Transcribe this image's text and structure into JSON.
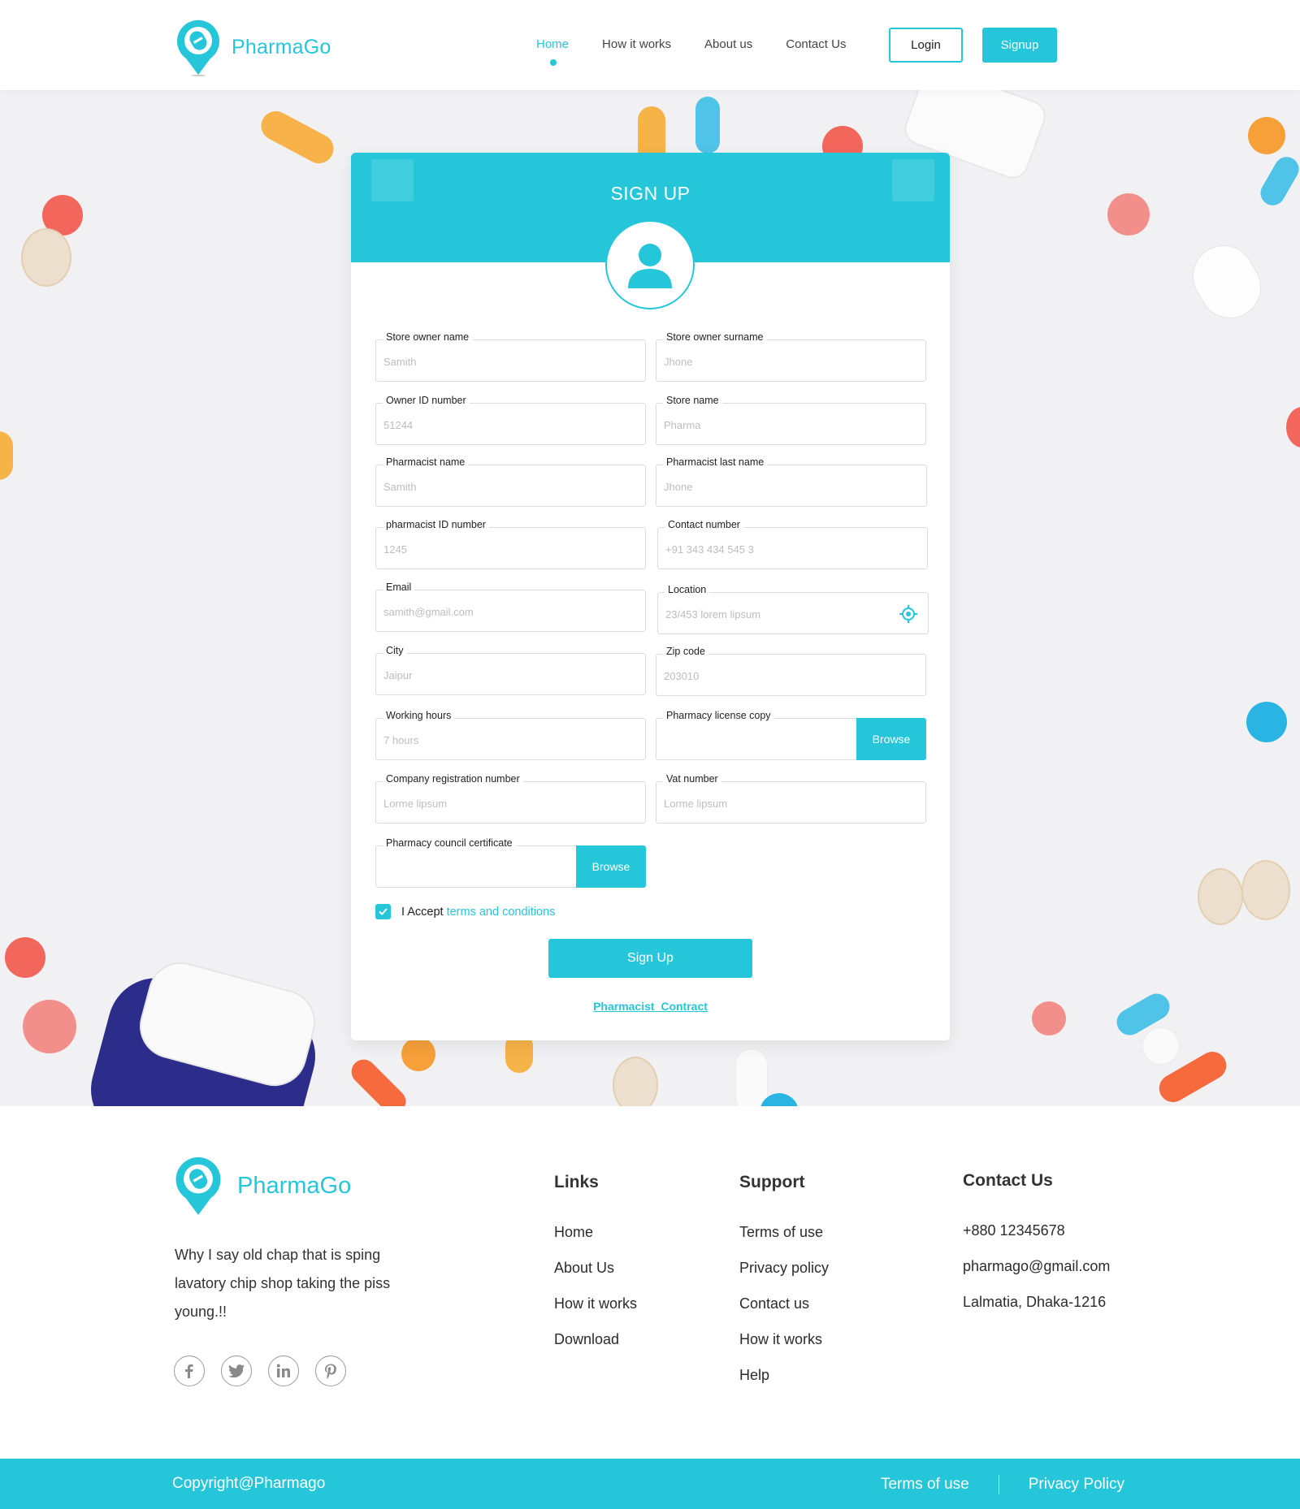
{
  "brand": {
    "name": "PharmaGo",
    "accent": "#26c6da"
  },
  "nav": {
    "links": [
      "Home",
      "How it works",
      "About us",
      "Contact Us"
    ],
    "active": "Home",
    "login": "Login",
    "signup": "Signup"
  },
  "form": {
    "title": "SIGN UP",
    "avatar_icon": "user-icon",
    "fields": {
      "store_owner_name": {
        "label": "Store owner name",
        "value": "Samith"
      },
      "store_owner_surname": {
        "label": "Store owner surname",
        "value": "Jhone"
      },
      "owner_id": {
        "label": "Owner ID number",
        "value": "51244"
      },
      "store_name": {
        "label": "Store name",
        "value": "Pharma"
      },
      "pharmacist_name": {
        "label": "Pharmacist name",
        "value": "Samith"
      },
      "pharmacist_last_name": {
        "label": "Pharmacist last name",
        "value": "Jhone"
      },
      "pharmacist_id": {
        "label": "pharmacist ID number",
        "value": "1245"
      },
      "contact_number": {
        "label": "Contact number",
        "value": "+91 343 434 545 3"
      },
      "email": {
        "label": "Email",
        "value": "samith@gmail.com"
      },
      "location": {
        "label": "Location",
        "value": "23/453 lorem lipsum"
      },
      "city": {
        "label": "City",
        "value": "Jaipur"
      },
      "zip": {
        "label": "Zip code",
        "value": "203010"
      },
      "working_hours": {
        "label": "Working hours",
        "value": "7 hours"
      },
      "license_copy": {
        "label": "Pharmacy license copy",
        "button": "Browse"
      },
      "company_reg": {
        "label": "Company registration number",
        "value": "Lorme lipsum"
      },
      "vat": {
        "label": "Vat number",
        "value": "Lorme lipsum"
      },
      "council_cert": {
        "label": "Pharmacy council certificate",
        "button": "Browse"
      }
    },
    "terms_prefix": "I Accept",
    "terms_link": "terms and conditions",
    "terms_checked": true,
    "submit": "Sign Up",
    "contract_link": "Pharmacist_Contract"
  },
  "footer": {
    "tagline": "Why I say old chap that is sping lavatory chip shop taking the piss  young.!!",
    "socials": [
      "facebook-icon",
      "twitter-icon",
      "linkedin-icon",
      "pinterest-icon"
    ],
    "links": {
      "title": "Links",
      "items": [
        "Home",
        "About Us",
        "How it works",
        "Download"
      ]
    },
    "support": {
      "title": "Support",
      "items": [
        "Terms of use",
        "Privacy policy",
        "Contact us",
        "How it works",
        "Help"
      ]
    },
    "contact": {
      "title": "Contact Us",
      "phone": "+880 12345678",
      "email": "pharmago@gmail.com",
      "address": "Lalmatia, Dhaka-1216"
    },
    "copyright": "Copyright@Pharmago",
    "bottom_links": [
      "Terms of use",
      "Privacy  Policy"
    ]
  }
}
